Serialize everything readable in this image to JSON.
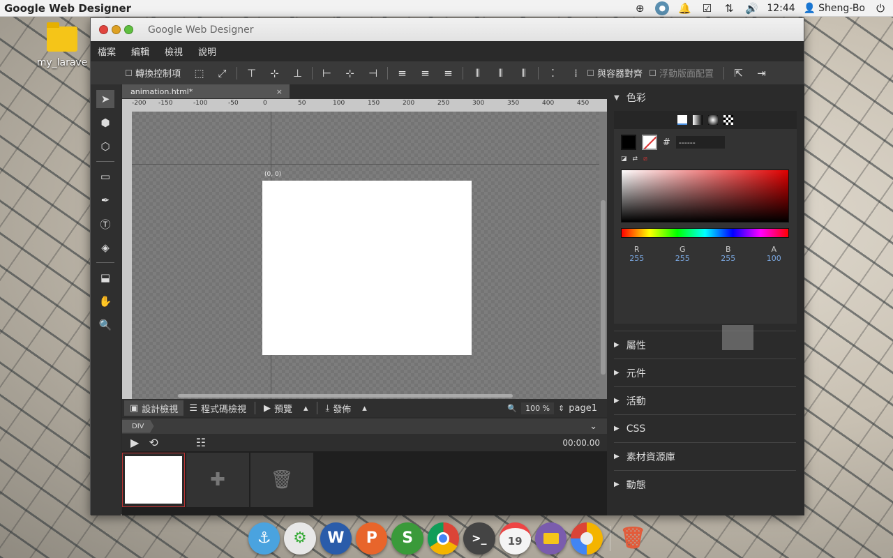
{
  "topbar": {
    "app_name": "Google Web Designer",
    "time": "12:44",
    "user": "Sheng-Bo"
  },
  "desktop": {
    "folder_label": "my_larave"
  },
  "window": {
    "title": "Google Web Designer"
  },
  "menu": [
    "檔案",
    "編輯",
    "檢視",
    "說明"
  ],
  "toolbar": {
    "transform_controls": "轉換控制項",
    "align_to_container": "與容器對齊",
    "float_layout": "浮動版面配置"
  },
  "document": {
    "tab_name": "animation.html*",
    "tab_close": "×",
    "origin_label": "(0, 0)"
  },
  "ruler": {
    "h_ticks": [
      "-200",
      "-150",
      "-100",
      "-50",
      "0",
      "50",
      "100",
      "150",
      "200",
      "250",
      "300",
      "350",
      "400",
      "450"
    ]
  },
  "viewbar": {
    "design_view": "設計檢視",
    "code_view": "程式碼檢視",
    "preview": "預覽",
    "publish": "發佈",
    "zoom_value": "100",
    "zoom_unit": "%",
    "page": "page1"
  },
  "timeline": {
    "tag": "DIV",
    "time": "00:00.00"
  },
  "rightpanel": {
    "color_title": "色彩",
    "hex_value": "------",
    "hex_prefix": "#",
    "rgba": [
      {
        "label": "R",
        "value": "255"
      },
      {
        "label": "G",
        "value": "255"
      },
      {
        "label": "B",
        "value": "255"
      },
      {
        "label": "A",
        "value": "100"
      }
    ],
    "sections": [
      "屬性",
      "元件",
      "活動",
      "CSS",
      "素材資源庫",
      "動態"
    ]
  },
  "dock": {
    "calendar_day": "19"
  }
}
